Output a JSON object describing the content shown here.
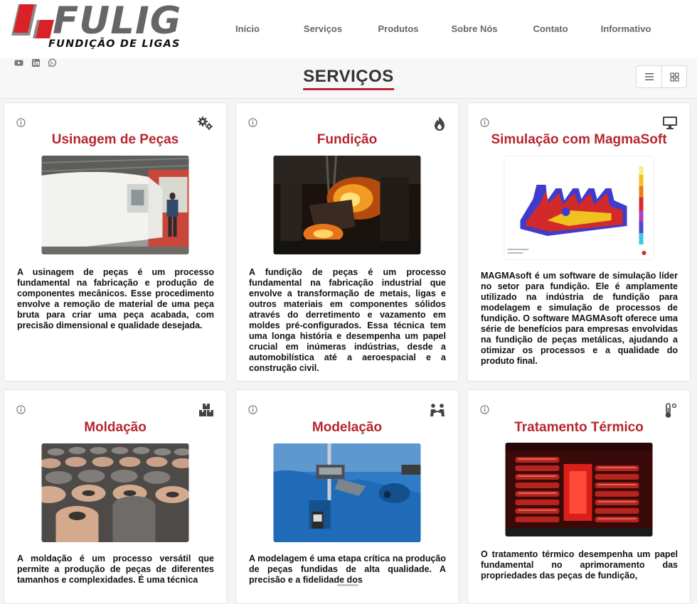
{
  "brand": {
    "name": "FULIG",
    "tagline": "FUNDIÇÃO DE LIGAS"
  },
  "nav": [
    "Início",
    "Serviços",
    "Produtos",
    "Sobre Nós",
    "Contato",
    "Informativo"
  ],
  "social": [
    "youtube-icon",
    "linkedin-icon",
    "whatsapp-icon"
  ],
  "page": {
    "title": "SERVIÇOS"
  },
  "view_options": [
    "list-view-icon",
    "grid-view-icon"
  ],
  "colors": {
    "accent": "#b7262e",
    "nav_text": "#666666",
    "background": "#f4f4f4"
  },
  "services": [
    {
      "title": "Usinagem de Peças",
      "icon": "gears-icon",
      "text": "A usinagem de peças é um processo fundamental na fabricação e produção de componentes mecânicos. Esse procedimento envolve a remoção de material de uma peça bruta para criar uma peça acabada, com precisão dimensional e qualidade desejada."
    },
    {
      "title": "Fundição",
      "icon": "fire-icon",
      "text": "A fundição de peças é um processo fundamental na fabricação industrial que envolve a transformação de metais, ligas e outros materiais em componentes sólidos através do derretimento e vazamento em moldes pré-configurados. Essa técnica tem uma longa história e desempenha um papel crucial em inúmeras indústrias, desde a automobilística até a aeroespacial e a construção civil."
    },
    {
      "title": "Simulação com MagmaSoft",
      "icon": "monitor-icon",
      "text": "MAGMAsoft é um software de simulação líder no setor para fundição. Ele é amplamente utilizado na indústria de fundição para modelagem e simulação de processos de fundição. O software MAGMAsoft oferece uma série de benefícios para empresas envolvidas na fundição de peças metálicas, ajudando a otimizar os processos e a qualidade do produto final."
    },
    {
      "title": "Moldação",
      "icon": "boxes-icon",
      "text": "A moldação é um processo versátil que permite a produção de peças de diferentes tamanhos e complexidades. É uma técnica"
    },
    {
      "title": "Modelação",
      "icon": "people-icon",
      "text": "A modelagem é uma etapa crítica na produção de peças fundidas de alta qualidade. A precisão e a fidelidade dos"
    },
    {
      "title": "Tratamento Térmico",
      "icon": "thermometer-icon",
      "text": "O tratamento térmico desempenha um papel fundamental no aprimoramento das propriedades das peças de fundição,"
    }
  ]
}
